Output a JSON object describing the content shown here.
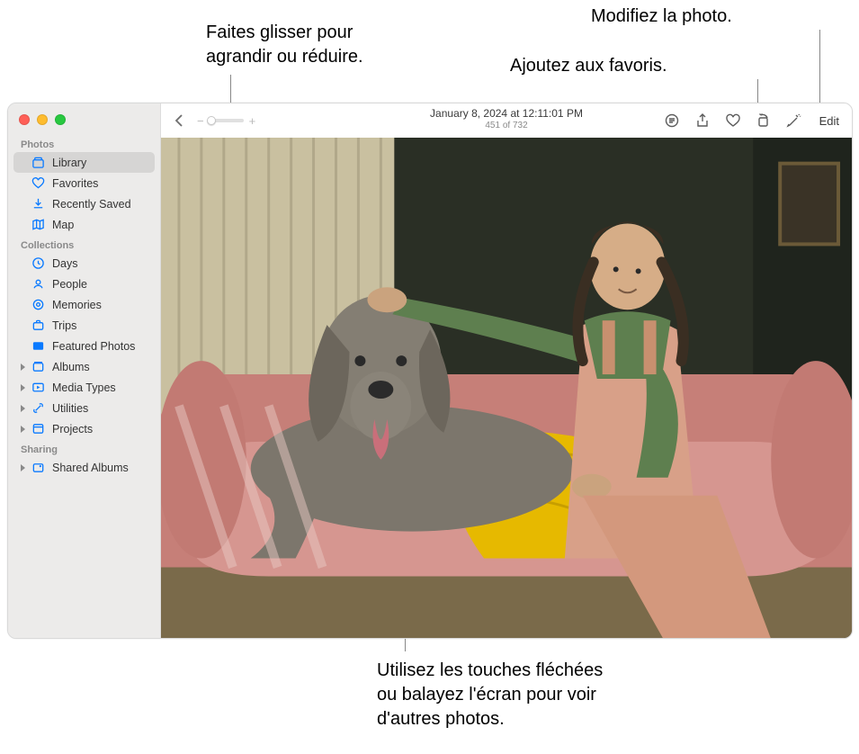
{
  "callouts": {
    "zoom": "Faites glisser pour\nagrandir ou réduire.",
    "favorite": "Ajoutez aux favoris.",
    "edit": "Modifiez la photo.",
    "navigate": "Utilisez les touches fléchées\nou balayez l'écran pour voir\nd'autres photos."
  },
  "toolbar": {
    "date": "January 8, 2024 at 12:11:01 PM",
    "counter": "451 of 732",
    "edit_label": "Edit",
    "zoom_minus": "−",
    "zoom_plus": "+"
  },
  "sidebar": {
    "section_photos": "Photos",
    "photos_items": [
      {
        "icon": "library",
        "label": "Library"
      },
      {
        "icon": "heart",
        "label": "Favorites"
      },
      {
        "icon": "download",
        "label": "Recently Saved"
      },
      {
        "icon": "map",
        "label": "Map"
      }
    ],
    "section_collections": "Collections",
    "collections_items": [
      {
        "icon": "clock",
        "label": "Days"
      },
      {
        "icon": "people",
        "label": "People"
      },
      {
        "icon": "sparkle",
        "label": "Memories"
      },
      {
        "icon": "suitcase",
        "label": "Trips"
      },
      {
        "icon": "featured",
        "label": "Featured Photos"
      }
    ],
    "expandable": [
      {
        "label": "Albums"
      },
      {
        "label": "Media Types"
      },
      {
        "label": "Utilities"
      },
      {
        "label": "Projects"
      }
    ],
    "section_sharing": "Sharing",
    "sharing_items": [
      {
        "label": "Shared Albums"
      }
    ]
  }
}
